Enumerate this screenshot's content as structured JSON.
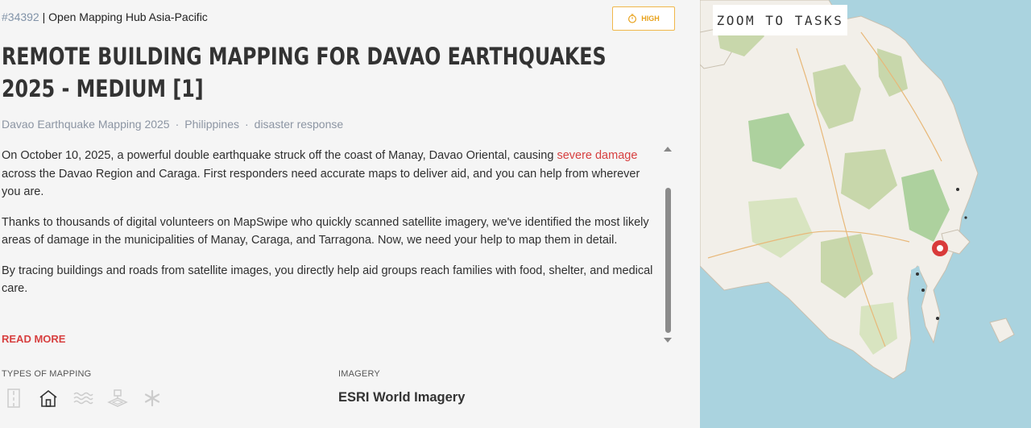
{
  "project": {
    "id": "#34392",
    "separator": "|",
    "organisation": "Open Mapping Hub Asia-Pacific",
    "priority": "HIGH",
    "title": "REMOTE BUILDING MAPPING FOR DAVAO EARTHQUAKES 2025 - MEDIUM [1]",
    "tags": [
      "Davao Earthquake Mapping 2025",
      "Philippines",
      "disaster response"
    ],
    "tag_separator": "·"
  },
  "description": {
    "p1_before": "On October 10, 2025, a powerful double earthquake struck off the coast of Manay, Davao Oriental, causing ",
    "p1_link": "severe damage",
    "p1_after": " across the Davao Region and Caraga. First responders need accurate maps to deliver aid, and you can help from wherever you are.",
    "p2": "Thanks to thousands of digital volunteers on MapSwipe who quickly scanned satellite imagery, we've identified the most likely areas of damage in the municipalities of Manay, Caraga, and Tarragona. Now, we need your help to map them in detail.",
    "p3": "By tracing buildings and roads from satellite images, you directly help aid groups reach families with food, shelter, and medical care.",
    "read_more": "READ MORE"
  },
  "mapping_types": {
    "label": "TYPES OF MAPPING",
    "icons": [
      "roads-icon",
      "buildings-icon",
      "waterways-icon",
      "land-use-icon",
      "other-icon"
    ],
    "active": "buildings-icon"
  },
  "imagery": {
    "label": "IMAGERY",
    "value": "ESRI World Imagery"
  },
  "map": {
    "zoom_button": "ZOOM TO TASKS",
    "water_color": "#aad3df",
    "land_color": "#f2efe9",
    "marker_color": "#d93a3a"
  }
}
